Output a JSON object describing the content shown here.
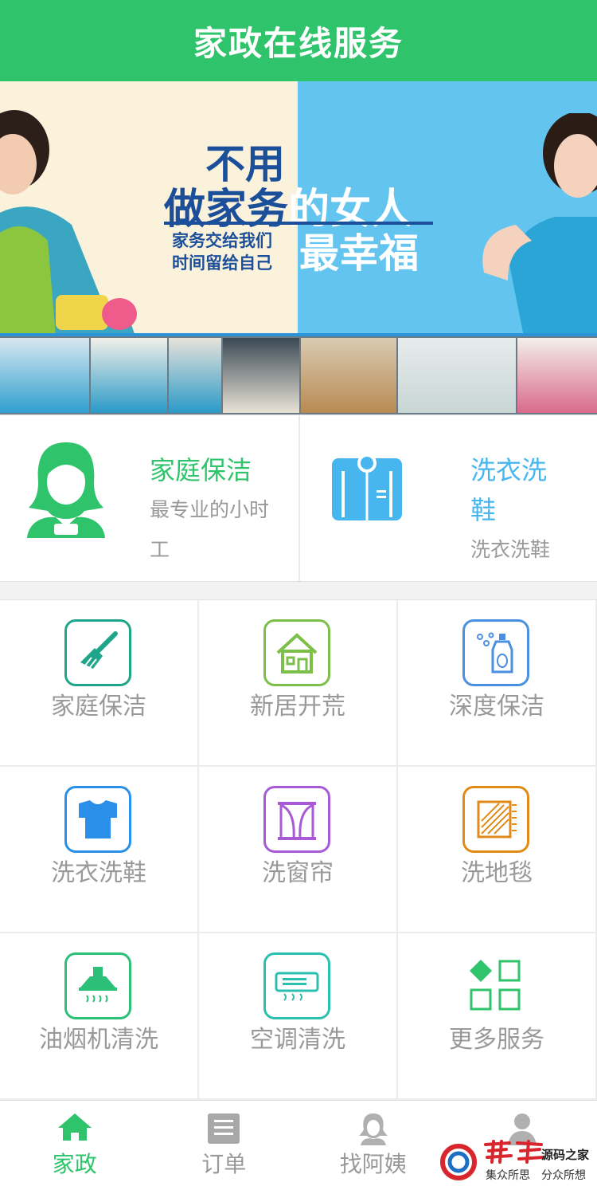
{
  "header": {
    "title": "家政在线服务"
  },
  "banner": {
    "headline_1": "不用",
    "headline_2a": "做家务",
    "headline_2b": "的女人",
    "sub_left": "家务交给我们\n时间留给自己",
    "sub_right": "最幸福"
  },
  "featured": [
    {
      "title": "家庭保洁",
      "subtitle_1": "最专业的小时",
      "subtitle_2": "工",
      "icon": "housekeeper-icon"
    },
    {
      "title_1": "洗衣洗",
      "title_2": "鞋",
      "subtitle": "洗衣洗鞋",
      "icon": "shirt-icon"
    }
  ],
  "services": [
    {
      "label": "家庭保洁",
      "icon": "broom-icon",
      "color": "#1fa58a"
    },
    {
      "label": "新居开荒",
      "icon": "house-icon",
      "color": "#7cc04a"
    },
    {
      "label": "深度保洁",
      "icon": "spray-bottle-icon",
      "color": "#4a8fe0"
    },
    {
      "label": "洗衣洗鞋",
      "icon": "shirt-icon",
      "color": "#2a8fe8"
    },
    {
      "label": "洗窗帘",
      "icon": "curtain-icon",
      "color": "#a85ad6"
    },
    {
      "label": "洗地毯",
      "icon": "carpet-icon",
      "color": "#e08a18"
    },
    {
      "label": "油烟机清洗",
      "icon": "range-hood-icon",
      "color": "#2bbf77"
    },
    {
      "label": "空调清洗",
      "icon": "air-conditioner-icon",
      "color": "#2bbfb0"
    },
    {
      "label": "更多服务",
      "icon": "more-grid-icon",
      "color": "#2fc46b"
    }
  ],
  "tabs": [
    {
      "label": "家政",
      "icon": "home-icon",
      "active": true
    },
    {
      "label": "订单",
      "icon": "order-icon",
      "active": false
    },
    {
      "label": "找阿姨",
      "icon": "nanny-icon",
      "active": false
    },
    {
      "label": "",
      "icon": "user-icon",
      "active": false
    }
  ],
  "watermark": {
    "brand": "源码之家",
    "line_left": "集众所思",
    "line_right": "分众所想"
  },
  "colors": {
    "primary": "#2fc46b",
    "light_blue": "#47b6ef",
    "text_gray": "#999999"
  }
}
